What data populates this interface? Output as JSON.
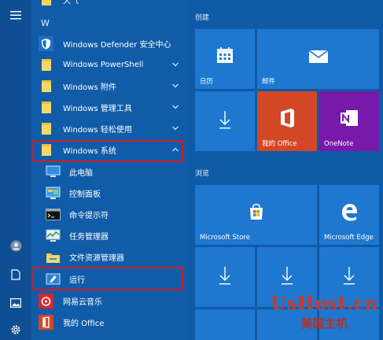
{
  "start_menu": {
    "app_list": {
      "section_letter": "W",
      "items": [
        {
          "label": "Windows Defender 安全中心",
          "icon": "shield-icon"
        },
        {
          "label": "Windows PowerShell",
          "icon": "folder-icon"
        },
        {
          "label": "Windows 附件",
          "icon": "folder-icon"
        },
        {
          "label": "Windows 管理工具",
          "icon": "folder-icon"
        },
        {
          "label": "Windows 轻松使用",
          "icon": "folder-icon"
        },
        {
          "label": "Windows 系统",
          "icon": "folder-icon",
          "expanded": true
        },
        {
          "label": "此电脑",
          "icon": "computer-icon"
        },
        {
          "label": "控制面板",
          "icon": "control-panel-icon"
        },
        {
          "label": "命令提示符",
          "icon": "command-prompt-icon"
        },
        {
          "label": "任务管理器",
          "icon": "task-manager-icon"
        },
        {
          "label": "文件资源管理器",
          "icon": "file-explorer-icon"
        },
        {
          "label": "运行",
          "icon": "run-icon"
        },
        {
          "label": "网易云音乐",
          "icon": "netease-music-icon"
        },
        {
          "label": "我的 Office",
          "icon": "office-icon"
        }
      ]
    },
    "rail": {
      "icons": [
        "hamburger-menu-icon",
        "user-avatar-icon",
        "documents-icon",
        "pictures-icon",
        "settings-icon"
      ]
    },
    "tiles": {
      "group1": {
        "title": "创建",
        "tiles": [
          {
            "label": "日历",
            "icon": "calendar-icon"
          },
          {
            "label": "邮件",
            "icon": "mail-icon"
          },
          {
            "label": "",
            "icon": "download-icon"
          },
          {
            "label": "我的 Office",
            "icon": "office-icon"
          },
          {
            "label": "OneNote",
            "icon": "onenote-icon"
          }
        ]
      },
      "group2": {
        "title": "浏览",
        "tiles": [
          {
            "label": "Microsoft Store",
            "icon": "store-icon"
          },
          {
            "label": "Microsoft Edge",
            "icon": "edge-icon"
          },
          {
            "label": "",
            "icon": "download-icon"
          },
          {
            "label": "",
            "icon": "download-icon"
          },
          {
            "label": "",
            "icon": "download-icon"
          }
        ]
      }
    },
    "colors": {
      "background": "#0f5aa6",
      "tile": "#1f78cf",
      "office_tile": "#d24726",
      "onenote_tile": "#7719aa",
      "highlight_box": "#d11b25"
    }
  },
  "watermark": {
    "line1": "UsHost.cn",
    "line2": "美国主机"
  }
}
